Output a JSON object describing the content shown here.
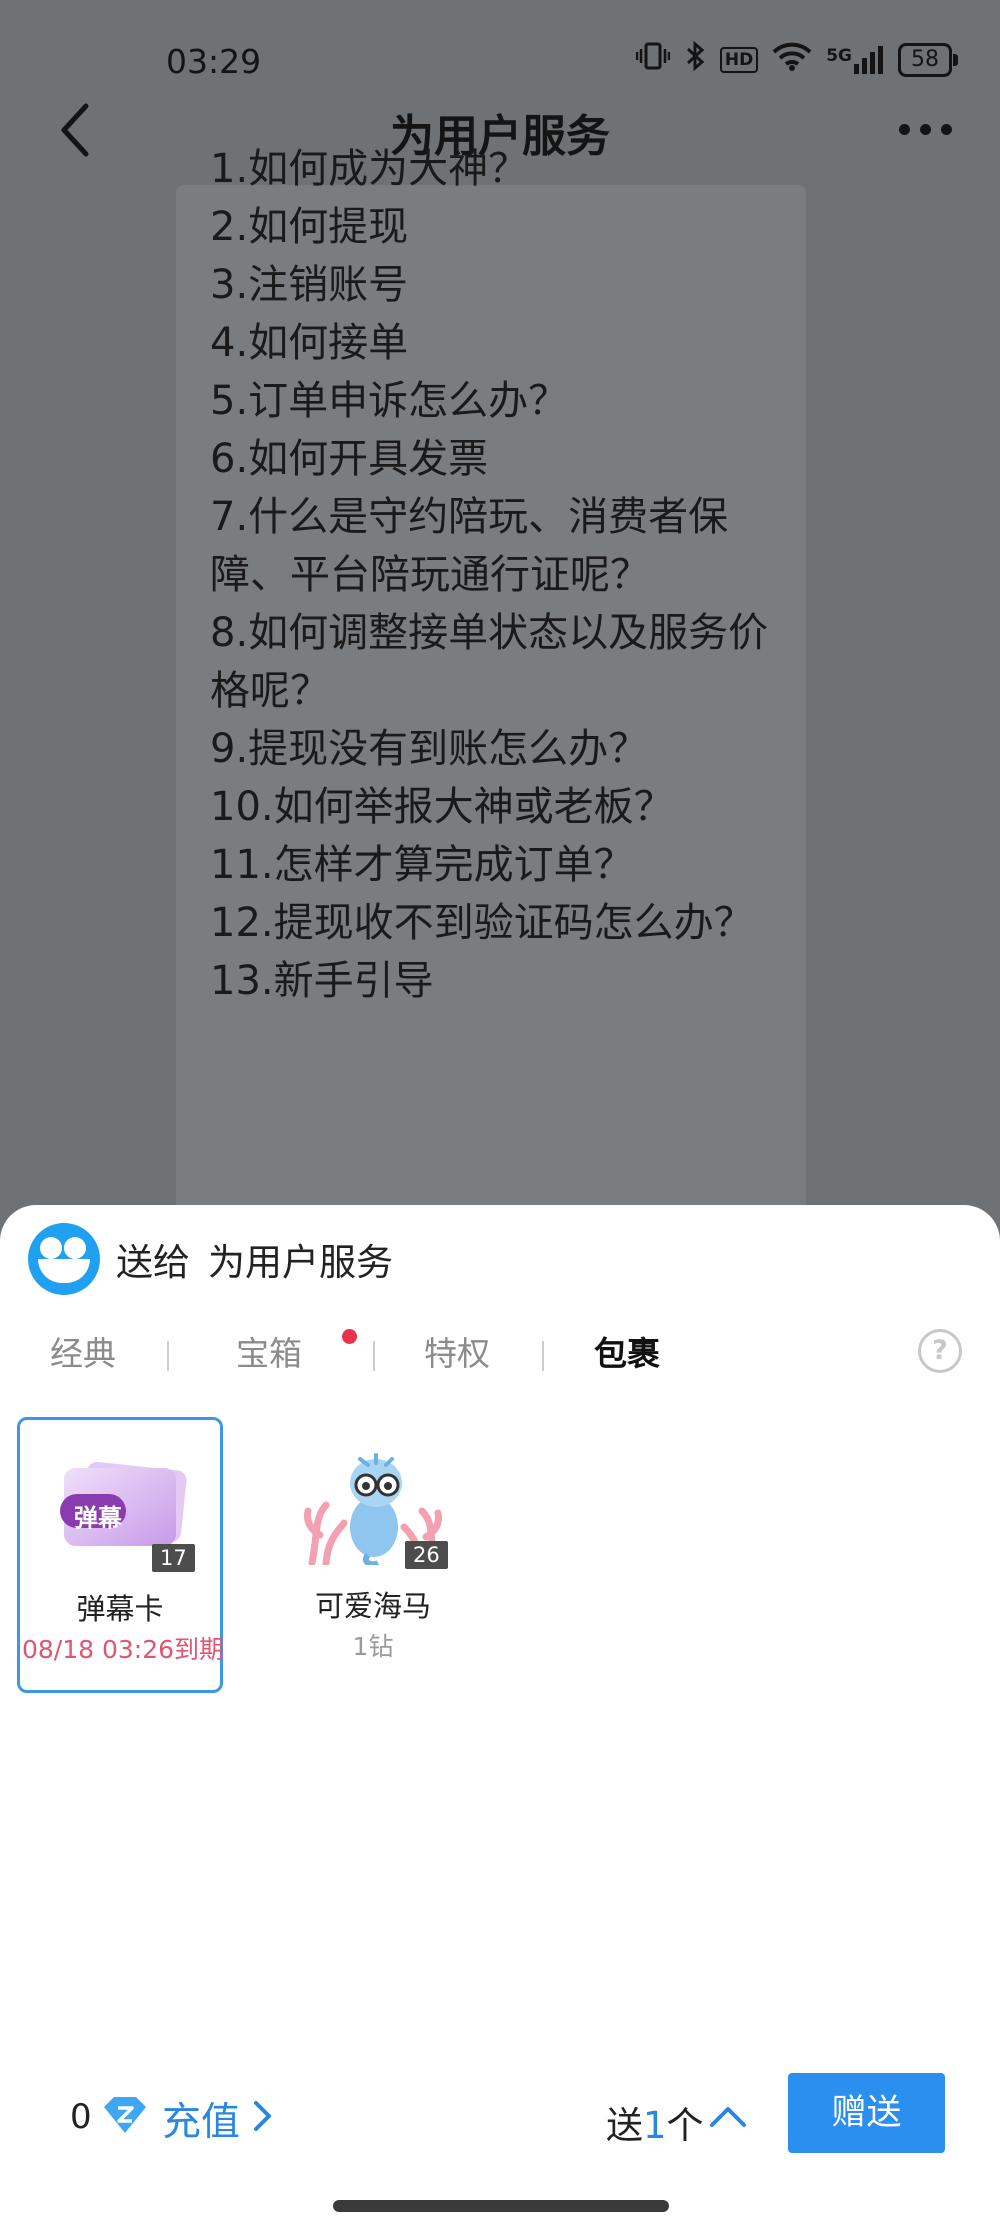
{
  "status_bar": {
    "time": "03:29",
    "network": "5G",
    "hd": "HD",
    "battery": "58"
  },
  "header": {
    "title": "为用户服务"
  },
  "message": {
    "lines": [
      "1.如何成为大神？",
      "2.如何提现",
      "3.注销账号",
      "4.如何接单",
      "5.订单申诉怎么办？",
      "6.如何开具发票",
      "7.什么是守约陪玩、消费者保障、平台陪玩通行证呢？",
      "8.如何调整接单状态以及服务价格呢？",
      "9.提现没有到账怎么办？",
      "10.如何举报大神或老板？",
      "11.怎样才算完成订单？",
      "12.提现收不到验证码怎么办？",
      "13.新手引导"
    ]
  },
  "sheet": {
    "send_to_label": "送给",
    "target_name": "为用户服务",
    "tabs": [
      {
        "label": "经典",
        "active": false
      },
      {
        "label": "宝箱",
        "active": false,
        "dot": true
      },
      {
        "label": "特权",
        "active": false
      },
      {
        "label": "包裹",
        "active": true
      }
    ],
    "help_icon": "?",
    "gifts": [
      {
        "name": "弹幕卡",
        "count": "17",
        "subtitle": "08/18 03:26到期",
        "card_text": "弹幕",
        "selected": true
      },
      {
        "name": "可爱海马",
        "count": "26",
        "subtitle": "1钻",
        "selected": false
      }
    ],
    "footer": {
      "balance": "0",
      "recharge_label": "充值",
      "send_prefix": "送",
      "send_quantity": "1",
      "send_suffix": "个",
      "gift_button": "赠送"
    }
  },
  "colors": {
    "accent": "#2b8fef",
    "expire": "#e35472",
    "dot": "#e8354c"
  }
}
